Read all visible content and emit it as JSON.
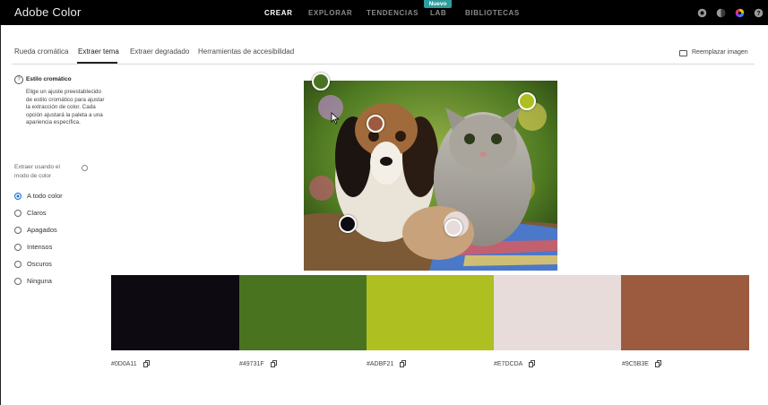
{
  "app": {
    "title": "Adobe Color",
    "nav": [
      "CREAR",
      "EXPLORAR",
      "TENDENCIAS",
      "LAB",
      "BIBLIOTECAS"
    ],
    "new_badge": "Nuevo",
    "icons": [
      "sun-icon",
      "contrast-icon",
      "color-wheel-icon",
      "help-icon"
    ]
  },
  "tabs": [
    "Rueda cromática",
    "Extraer tema",
    "Extraer degradado",
    "Herramientas de accesibilidad"
  ],
  "active_tab": "Extraer tema",
  "replace_image": "Reemplazar imagen",
  "sidebar": {
    "section_title": "Estilo cromático",
    "description": "Elige un ajuste preestablecido de estilo cromático para ajustar la extracción de color. Cada opción ajustará la paleta a una apariencia específica.",
    "mode_label": "Extraer usando el modo de color",
    "options": [
      "A todo color",
      "Claros",
      "Apagados",
      "Intensos",
      "Oscuros",
      "Ninguna"
    ],
    "selected": "A todo color"
  },
  "palette": [
    {
      "hex": "#0D0A11",
      "color": "#0D0A11"
    },
    {
      "hex": "#49731F",
      "color": "#49731F"
    },
    {
      "hex": "#ADBF21",
      "color": "#ADBF21"
    },
    {
      "hex": "#E7DCDA",
      "color": "#E7DCDA"
    },
    {
      "hex": "#9C5B3E",
      "color": "#9C5B3E"
    }
  ]
}
